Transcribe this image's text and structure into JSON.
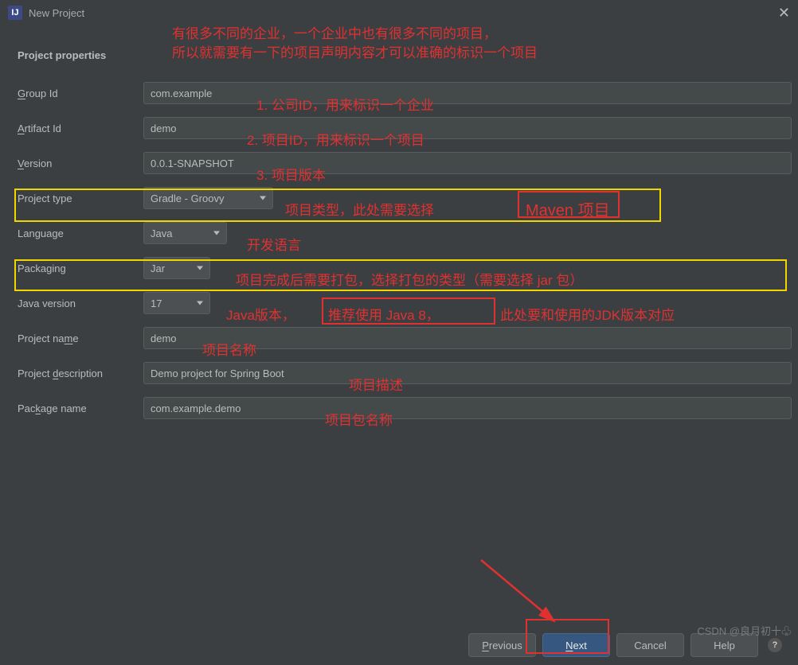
{
  "titlebar": {
    "title": "New Project",
    "app_icon_letter": "IJ"
  },
  "section": {
    "title": "Project properties"
  },
  "labels": {
    "group": "Group Id",
    "artifact": "Artifact Id",
    "version": "Version",
    "projtype": "Project type",
    "language": "Language",
    "packaging": "Packaging",
    "jver": "Java version",
    "pname": "Project name",
    "pdesc": "Project description",
    "pkgname": "Package name"
  },
  "fields": {
    "group": "com.example",
    "artifact": "demo",
    "version": "0.0.1-SNAPSHOT",
    "projtype": "Gradle - Groovy",
    "language": "Java",
    "packaging": "Jar",
    "jver": "17",
    "pname": "demo",
    "pdesc": "Demo project for Spring Boot",
    "pkgname": "com.example.demo"
  },
  "footer": {
    "previous": "Previous",
    "next": "Next",
    "cancel": "Cancel",
    "help": "Help"
  },
  "annotations": {
    "top1": "有很多不同的企业，一个企业中也有很多不同的项目，",
    "top2": "所以就需要有一下的项目声明内容才可以准确的标识一个项目",
    "f1": "1. 公司ID，用来标识一个企业",
    "f2": "2. 项目ID，用来标识一个项目",
    "f3": "3. 项目版本",
    "projtype_l": "项目类型，此处需要选择",
    "projtype_r": "Maven 项目",
    "lang": "开发语言",
    "pack": "项目完成后需要打包，选择打包的类型（需要选择 jar 包）",
    "jver_l": "Java版本，",
    "jver_m": "推荐使用 Java 8，",
    "jver_r": "此处要和使用的JDK版本对应",
    "pname": "项目名称",
    "pdesc": "项目描述",
    "pkgname": "项目包名称"
  },
  "watermark": "CSDN @良月初十♧"
}
